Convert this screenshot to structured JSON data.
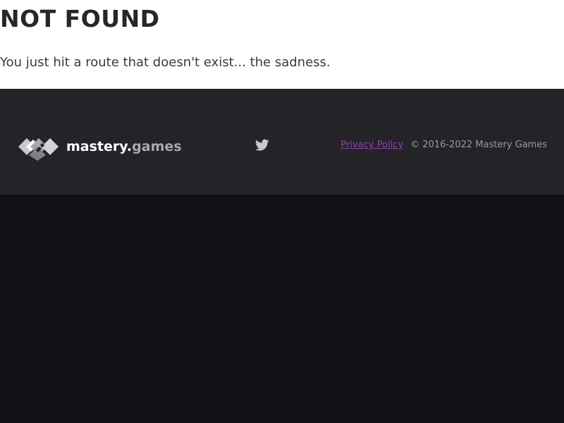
{
  "page": {
    "title": "NOT FOUND",
    "message": "You just hit a route that doesn't exist... the sadness."
  },
  "footer": {
    "logo": {
      "text_primary": "mastery.",
      "text_secondary": "games",
      "icon": "mastery-games-logo-icon"
    },
    "social": {
      "icon": "twitter-icon"
    },
    "privacy_label": "Privacy Policy",
    "copyright": "© 2016-2022 Mastery Games"
  },
  "colors": {
    "top_background": "#ffffff",
    "footer_background": "#242328",
    "page_background": "#121116",
    "title_text": "#27272b",
    "link_accent": "#8e44ad"
  }
}
